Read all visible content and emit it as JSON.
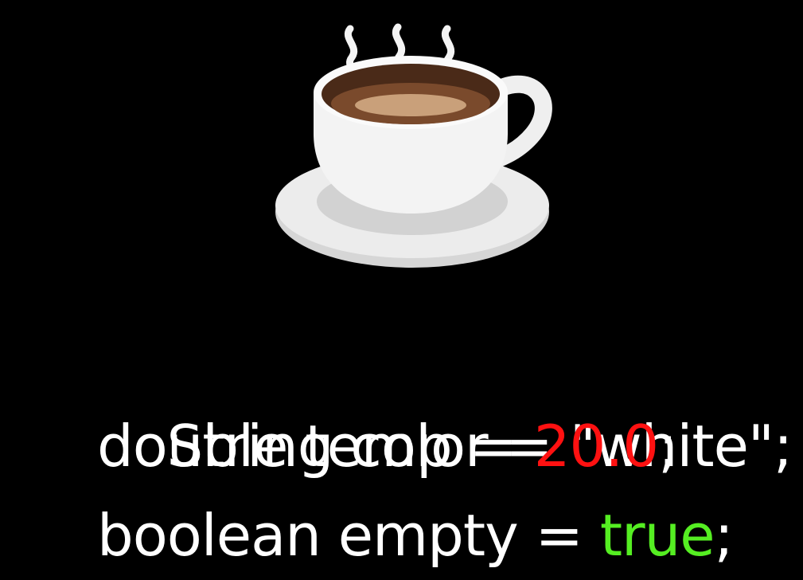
{
  "colors": {
    "background": "#000000",
    "text": "#ffffff",
    "number_literal": "#ff1111",
    "boolean_literal": "#55ee22",
    "cup": "#f2f2f2",
    "saucer": "#e0e0e0",
    "coffee": "#7a4a2c"
  },
  "illustration": {
    "icon": "coffee-cup-icon"
  },
  "code": {
    "line1": {
      "text": "String color = \"white\";"
    },
    "line2": {
      "prefix": "double temp = ",
      "value": "20.0",
      "suffix": ";"
    },
    "line3": {
      "prefix": "boolean empty = ",
      "value": "true",
      "suffix": ";"
    }
  }
}
